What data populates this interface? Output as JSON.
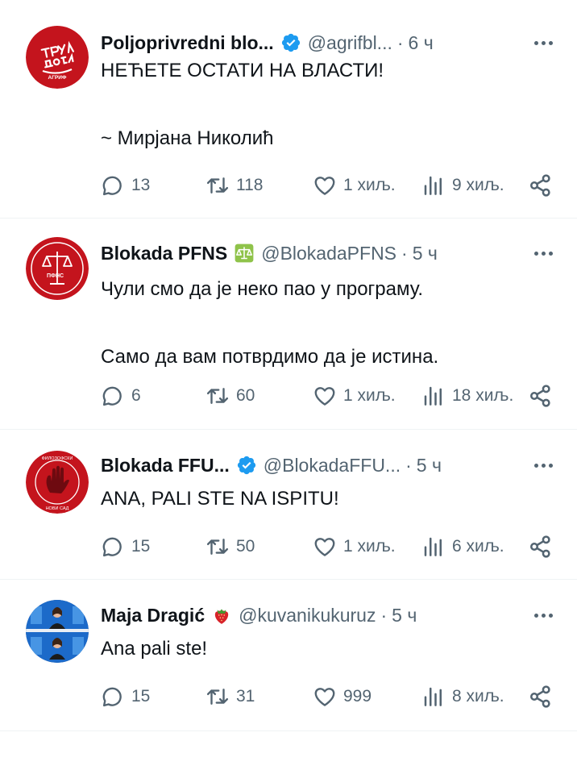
{
  "tweets": [
    {
      "name": "Poljoprivredni blo...",
      "badge": "verified",
      "handle": "@agrifbl...",
      "sep": "·",
      "time": "6 ч",
      "text": "НЕЋЕТЕ ОСТАТИ НА ВЛАСТИ!\n\n~ Мирјана Николић",
      "replies": "13",
      "reposts": "118",
      "likes": "1 хиљ.",
      "views": "9 хиљ.",
      "avatar_label": "ТРУЛО ДО СРЖИ"
    },
    {
      "name": "Blokada PFNS",
      "badge": "scales-emoji",
      "handle": "@BlokadaPFNS",
      "sep": "·",
      "time": "5 ч",
      "text": "Чули смо да је неко пао у програму.\n\nСамо да вам потврдимо да је истина.",
      "replies": "6",
      "reposts": "60",
      "likes": "1 хиљ.",
      "views": "18 хиљ.",
      "avatar_label": "ПФНС"
    },
    {
      "name": "Blokada FFU...",
      "badge": "verified",
      "handle": "@BlokadaFFU...",
      "sep": "·",
      "time": "5 ч",
      "text": "ANA, PALI STE NA ISPITU!",
      "replies": "15",
      "reposts": "50",
      "likes": "1 хиљ.",
      "views": "6 хиљ.",
      "avatar_label": "ФИЛОЗОФСКИ ФАКУЛТЕТ НОВИ САД"
    },
    {
      "name": "Maja Dragić",
      "badge": "strawberry-emoji",
      "handle": "@kuvanikukuruz",
      "sep": "·",
      "time": "5 ч",
      "text": "Ana pali ste!",
      "replies": "15",
      "reposts": "31",
      "likes": "999",
      "views": "8 хиљ.",
      "avatar_label": ""
    }
  ],
  "colors": {
    "verified": "#1d9bf0",
    "text": "#0f1419",
    "secondary": "#536471",
    "border": "#eff3f4",
    "avatar_red": "#c4141d"
  }
}
